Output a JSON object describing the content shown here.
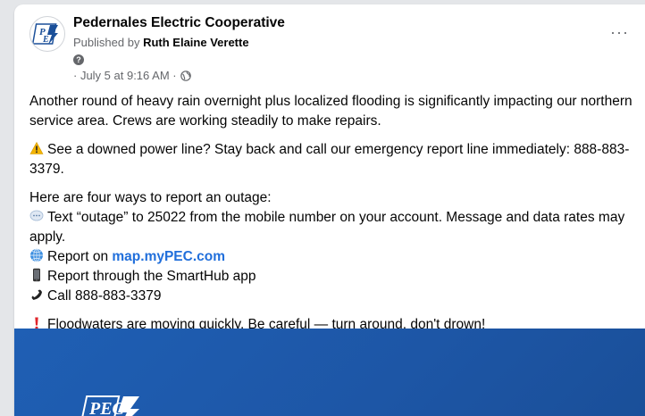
{
  "post": {
    "page_name": "Pedernales Electric Cooperative",
    "published_prefix": "Published by",
    "publisher": "Ruth Elaine Verette",
    "help_glyph": "?",
    "timestamp": "· July 5 at 9:16 AM ·",
    "more_label": "···"
  },
  "content": {
    "para1": "Another round of heavy rain overnight plus localized flooding is significantly impacting our northern service area. Crews are working steadily to make repairs.",
    "para2": "See a downed power line? Stay back and call our emergency report line immediately: 888-883-3379.",
    "intro": "Here are four ways to report an outage:",
    "item1": "Text “outage” to 25022 from the mobile number on your account. Message and data rates may apply.",
    "item2_prefix": "Report on ",
    "item2_link": "map.myPEC.com",
    "item3": "Report through the SmartHub app",
    "item4": "Call 888-883-3379",
    "warning": "Floodwaters are moving quickly. Be careful — turn around, don't drown!"
  },
  "logo_text": "PEC",
  "icons": {
    "warning": "warning-icon",
    "speech": "speech-bubble-icon",
    "globe": "globe-icon",
    "phone": "mobile-phone-icon",
    "receiver": "telephone-receiver-icon",
    "exclamation": "exclamation-icon"
  },
  "colors": {
    "link": "#216fdb",
    "brand_blue": "#1f5fb4",
    "secondary_text": "#65676b"
  }
}
